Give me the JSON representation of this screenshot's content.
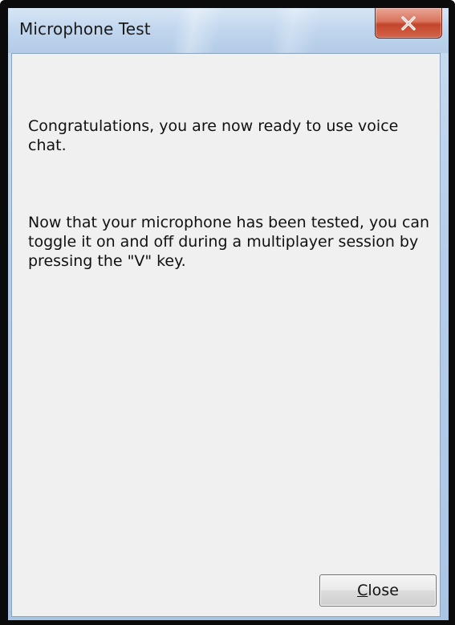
{
  "window": {
    "title": "Microphone Test",
    "close_icon": "close-x-icon"
  },
  "message": {
    "paragraph1": "Congratulations, you are now ready to use voice chat.",
    "paragraph2": "Now that your microphone has been tested, you can toggle it on and off during a multiplayer session by pressing the \"V\" key."
  },
  "buttons": {
    "close_mnemonic": "C",
    "close_rest": "lose"
  },
  "colors": {
    "close_button_red": "#c2452b",
    "titlebar_blue": "#c2d7ee",
    "client_background": "#f0f0f0"
  }
}
